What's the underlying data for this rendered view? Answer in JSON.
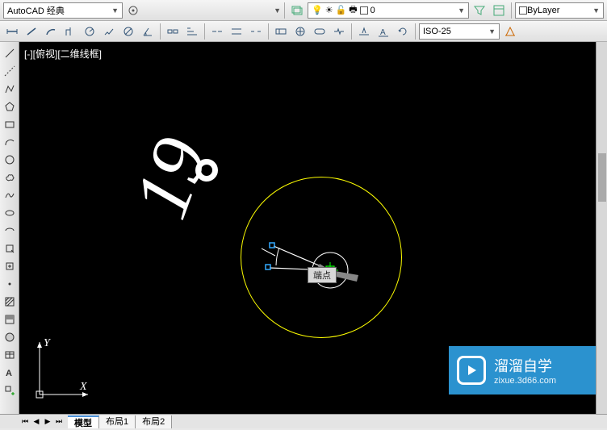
{
  "header": {
    "workspace_combo": "AutoCAD 经典",
    "layer_combo_value": "0",
    "bylayer_combo": "ByLayer",
    "dim_style_combo": "ISO-25"
  },
  "view": {
    "label": "[-][俯视][二维线框]",
    "angle_value": "19",
    "osnap_tooltip": "端点",
    "ucs_y": "Y",
    "ucs_x": "X"
  },
  "tabs": {
    "model": "模型",
    "layout1": "布局1",
    "layout2": "布局2"
  },
  "watermark": {
    "brand": "溜溜自学",
    "url": "zixue.3d66.com"
  },
  "icons": {
    "gear": "gear",
    "layers": "layers",
    "bulb": "bulb",
    "sun": "sun",
    "lock": "lock",
    "search": "search",
    "filter": "filter"
  }
}
